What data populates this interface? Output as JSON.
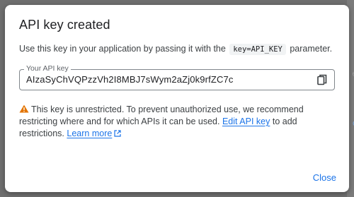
{
  "backdrop": {
    "right_text_1": "e",
    "right_text_2": "c"
  },
  "dialog": {
    "title": "API key created",
    "description_before": "Use this key in your application by passing it with the",
    "description_code": "key=API_KEY",
    "description_after": "parameter.",
    "field": {
      "label": "Your API key",
      "value": "AIzaSyChVQPzzVh2I8MBJ7sWym2aZj0k9rfZC7c",
      "copy_icon": "copy-icon"
    },
    "warning": {
      "icon": "warning-icon",
      "text_before": "This key is unrestricted. To prevent unauthorized use, we recommend restricting where and for which APIs it can be used.",
      "edit_link": "Edit API key",
      "text_middle": "to add restrictions.",
      "learn_more_link": "Learn more",
      "learn_more_icon": "open-in-new-icon"
    },
    "close_label": "Close"
  },
  "colors": {
    "accent": "#1a73e8",
    "warning": "#e37400",
    "backdrop": "#6f6f6f"
  }
}
